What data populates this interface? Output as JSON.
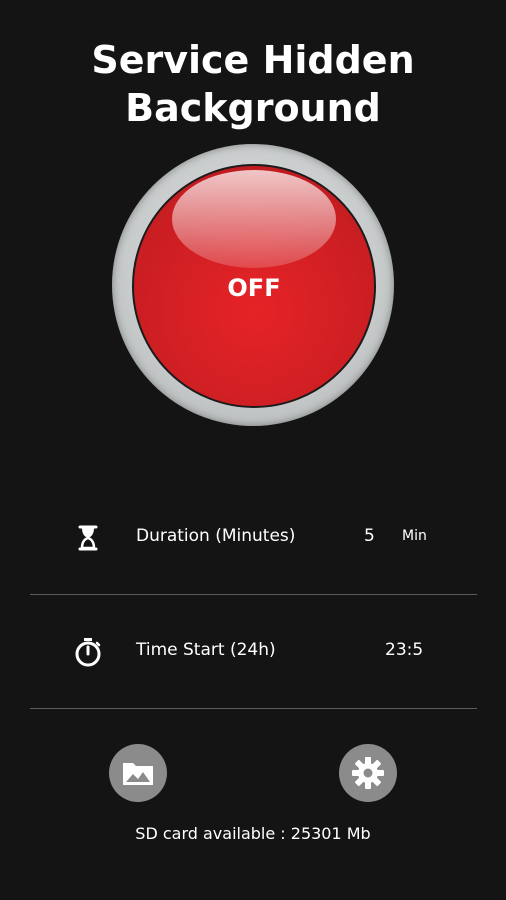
{
  "header": {
    "title_line1": "Service Hidden",
    "title_line2": "Background"
  },
  "toggle": {
    "state_label": "OFF"
  },
  "settings": {
    "duration": {
      "label": "Duration (Minutes)",
      "value": "5",
      "unit": "Min",
      "icon": "hourglass-icon"
    },
    "time_start": {
      "label": "Time Start (24h)",
      "value": "23:5",
      "icon": "stopwatch-icon"
    }
  },
  "actions": {
    "gallery_icon": "gallery-icon",
    "settings_icon": "gear-icon"
  },
  "footer": {
    "sd_card_text": "SD card available : 25301 Mb"
  },
  "colors": {
    "background": "#141414",
    "button_red": "#e62327",
    "ring_gray": "#c8cbcb",
    "action_gray": "#8b8b8b",
    "divider": "#5c5c5c"
  }
}
